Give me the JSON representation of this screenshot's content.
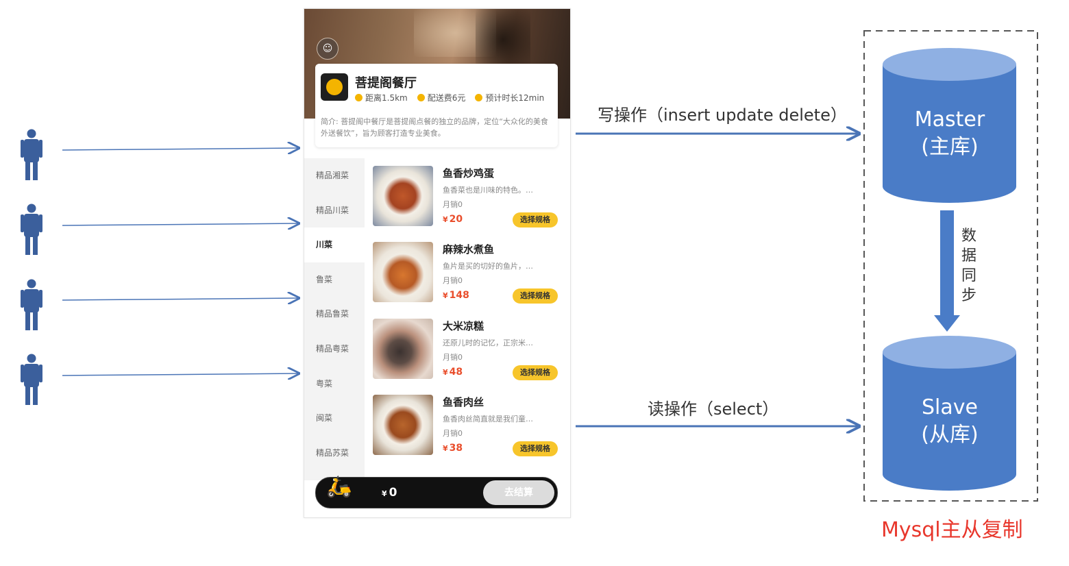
{
  "diagram": {
    "write_label": "写操作（insert  update  delete）",
    "read_label": "读操作（select）",
    "sync_label": [
      "数",
      "据",
      "同",
      "步"
    ],
    "master": {
      "line1": "Master",
      "line2": "(主库)"
    },
    "slave": {
      "line1": "Slave",
      "line2": "(从库)"
    },
    "caption": "Mysql主从复制",
    "colors": {
      "db_fill": "#4a7cc7",
      "db_top": "#8fb0e3",
      "arrow": "#4a74b6",
      "caption": "#e8372c",
      "person": "#3b5f9c"
    }
  },
  "app": {
    "shop_name": "菩提阁餐厅",
    "meta": [
      "距离1.5km",
      "配送费6元",
      "预计时长12min"
    ],
    "description": "简介: 菩提阁中餐厅是菩提阁点餐的独立的品牌，定位“大众化的美食外送餐饮”，旨为顾客打造专业美食。",
    "categories": [
      "精品湘菜",
      "精品川菜",
      "川菜",
      "鲁菜",
      "精品鲁菜",
      "精品粤菜",
      "粤菜",
      "闽菜",
      "精品苏菜"
    ],
    "active_category": "川菜",
    "dishes": [
      {
        "name": "鱼香炒鸡蛋",
        "desc": "鱼香菜也是川味的特色。…",
        "sold": "月销0",
        "price": "20"
      },
      {
        "name": "麻辣水煮鱼",
        "desc": "鱼片是买的切好的鱼片，…",
        "sold": "月销0",
        "price": "148"
      },
      {
        "name": "大米凉糕",
        "desc": "还原儿时的记忆，正宗米…",
        "sold": "月销0",
        "price": "48"
      },
      {
        "name": "鱼香肉丝",
        "desc": "鱼香肉丝简直就是我们童…",
        "sold": "月销0",
        "price": "38"
      }
    ],
    "spec_button": "选择规格",
    "currency": "¥",
    "cart_total": "0",
    "checkout": "去结算"
  }
}
